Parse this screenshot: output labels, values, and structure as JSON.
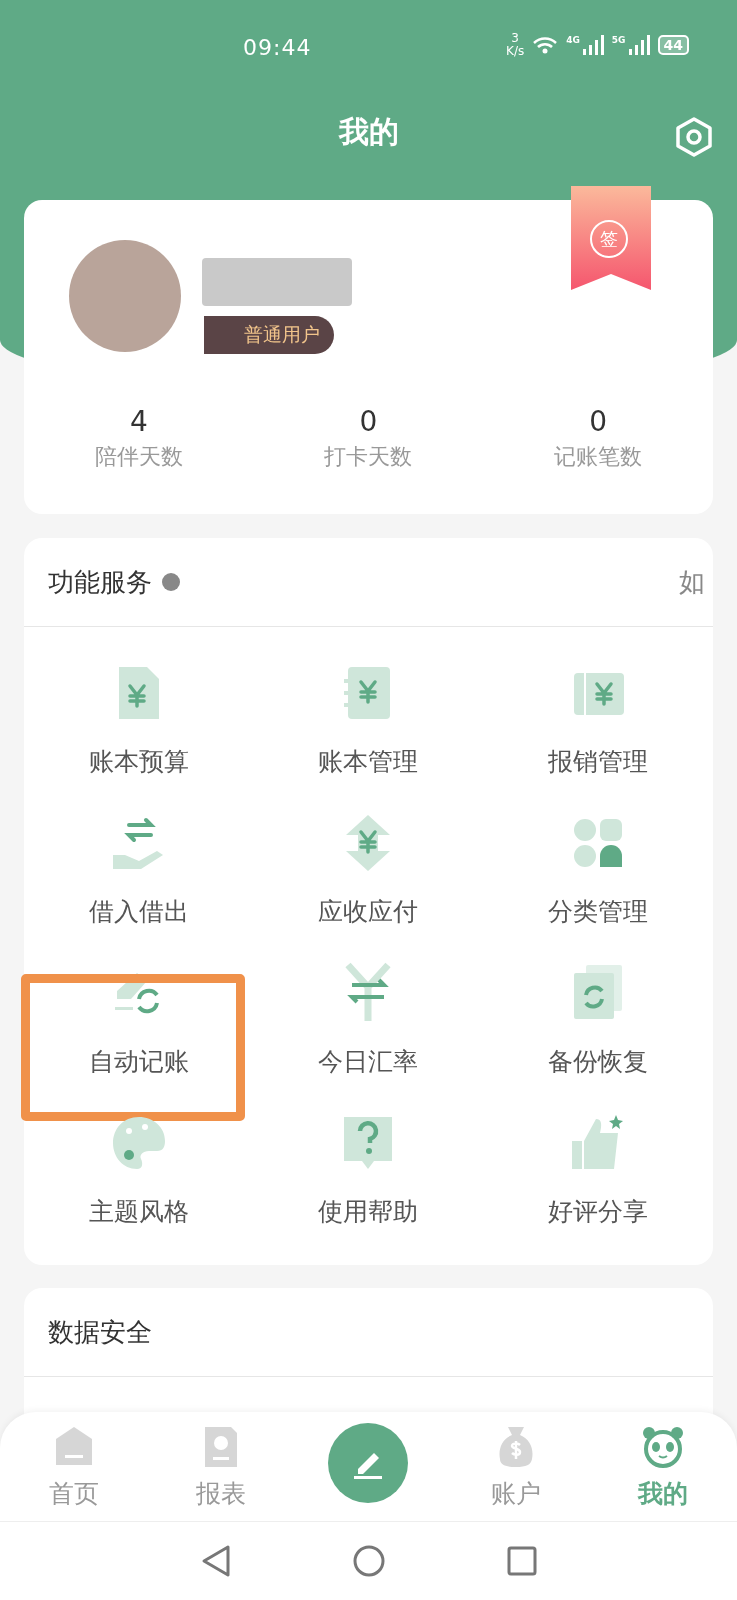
{
  "status_bar": {
    "time": "09:44",
    "speed_value": "3",
    "speed_unit": "K/s",
    "network_4g": "4G",
    "network_5g": "5G",
    "battery": "44"
  },
  "header": {
    "title": "我的"
  },
  "profile": {
    "badge": "普通用户",
    "sign_in": "签",
    "stats": [
      {
        "value": "4",
        "label": "陪伴天数"
      },
      {
        "value": "0",
        "label": "打卡天数"
      },
      {
        "value": "0",
        "label": "记账笔数"
      }
    ]
  },
  "services": {
    "title": "功能服务",
    "trailing": "如",
    "items": [
      {
        "label": "账本预算",
        "kind": "budget",
        "highlighted": false
      },
      {
        "label": "账本管理",
        "kind": "ledger",
        "highlighted": false
      },
      {
        "label": "报销管理",
        "kind": "ticket",
        "highlighted": false
      },
      {
        "label": "借入借出",
        "kind": "hand",
        "highlighted": false
      },
      {
        "label": "应收应付",
        "kind": "updown",
        "highlighted": false
      },
      {
        "label": "分类管理",
        "kind": "category",
        "highlighted": false
      },
      {
        "label": "自动记账",
        "kind": "auto",
        "highlighted": true
      },
      {
        "label": "今日汇率",
        "kind": "rate",
        "highlighted": false
      },
      {
        "label": "备份恢复",
        "kind": "backup",
        "highlighted": false
      },
      {
        "label": "主题风格",
        "kind": "palette",
        "highlighted": false
      },
      {
        "label": "使用帮助",
        "kind": "help",
        "highlighted": false
      },
      {
        "label": "好评分享",
        "kind": "thumb",
        "highlighted": false
      }
    ]
  },
  "security": {
    "title": "数据安全"
  },
  "nav": {
    "tabs": [
      {
        "label": "首页",
        "kind": "home",
        "selected": false
      },
      {
        "label": "报表",
        "kind": "report",
        "selected": false
      },
      {
        "label": "账户",
        "kind": "moneybag",
        "selected": false
      },
      {
        "label": "我的",
        "kind": "panda",
        "selected": true
      }
    ]
  }
}
